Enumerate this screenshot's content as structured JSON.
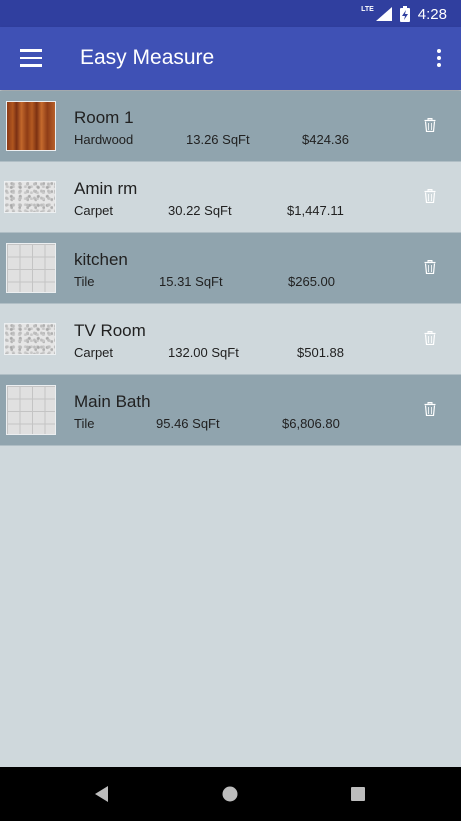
{
  "status": {
    "time": "4:28",
    "network": "LTE"
  },
  "app_bar": {
    "title": "Easy Measure",
    "menu_icon": "hamburger-menu-icon",
    "overflow_icon": "more-vert-icon"
  },
  "rooms": [
    {
      "name": "Room 1",
      "floor": "Hardwood",
      "sqft": "13.26 SqFt",
      "price": "$424.36",
      "texture": "hardwood"
    },
    {
      "name": "Amin rm",
      "floor": "Carpet",
      "sqft": "30.22 SqFt",
      "price": "$1,447.11",
      "texture": "carpet"
    },
    {
      "name": "kitchen",
      "floor": "Tile",
      "sqft": "15.31 SqFt",
      "price": "$265.00",
      "texture": "tile"
    },
    {
      "name": "TV Room",
      "floor": "Carpet",
      "sqft": "132.00 SqFt",
      "price": "$501.88",
      "texture": "carpet"
    },
    {
      "name": "Main Bath",
      "floor": "Tile",
      "sqft": "95.46 SqFt",
      "price": "$6,806.80",
      "texture": "tile"
    }
  ],
  "colors": {
    "status_bar": "#303f9f",
    "app_bar": "#3f51b5",
    "row_dark": "#90a4ae",
    "row_light": "#cfd8dc",
    "background": "#cfd8dc"
  },
  "nav": {
    "back_icon": "back-triangle-icon",
    "home_icon": "home-circle-icon",
    "recents_icon": "recents-square-icon"
  }
}
